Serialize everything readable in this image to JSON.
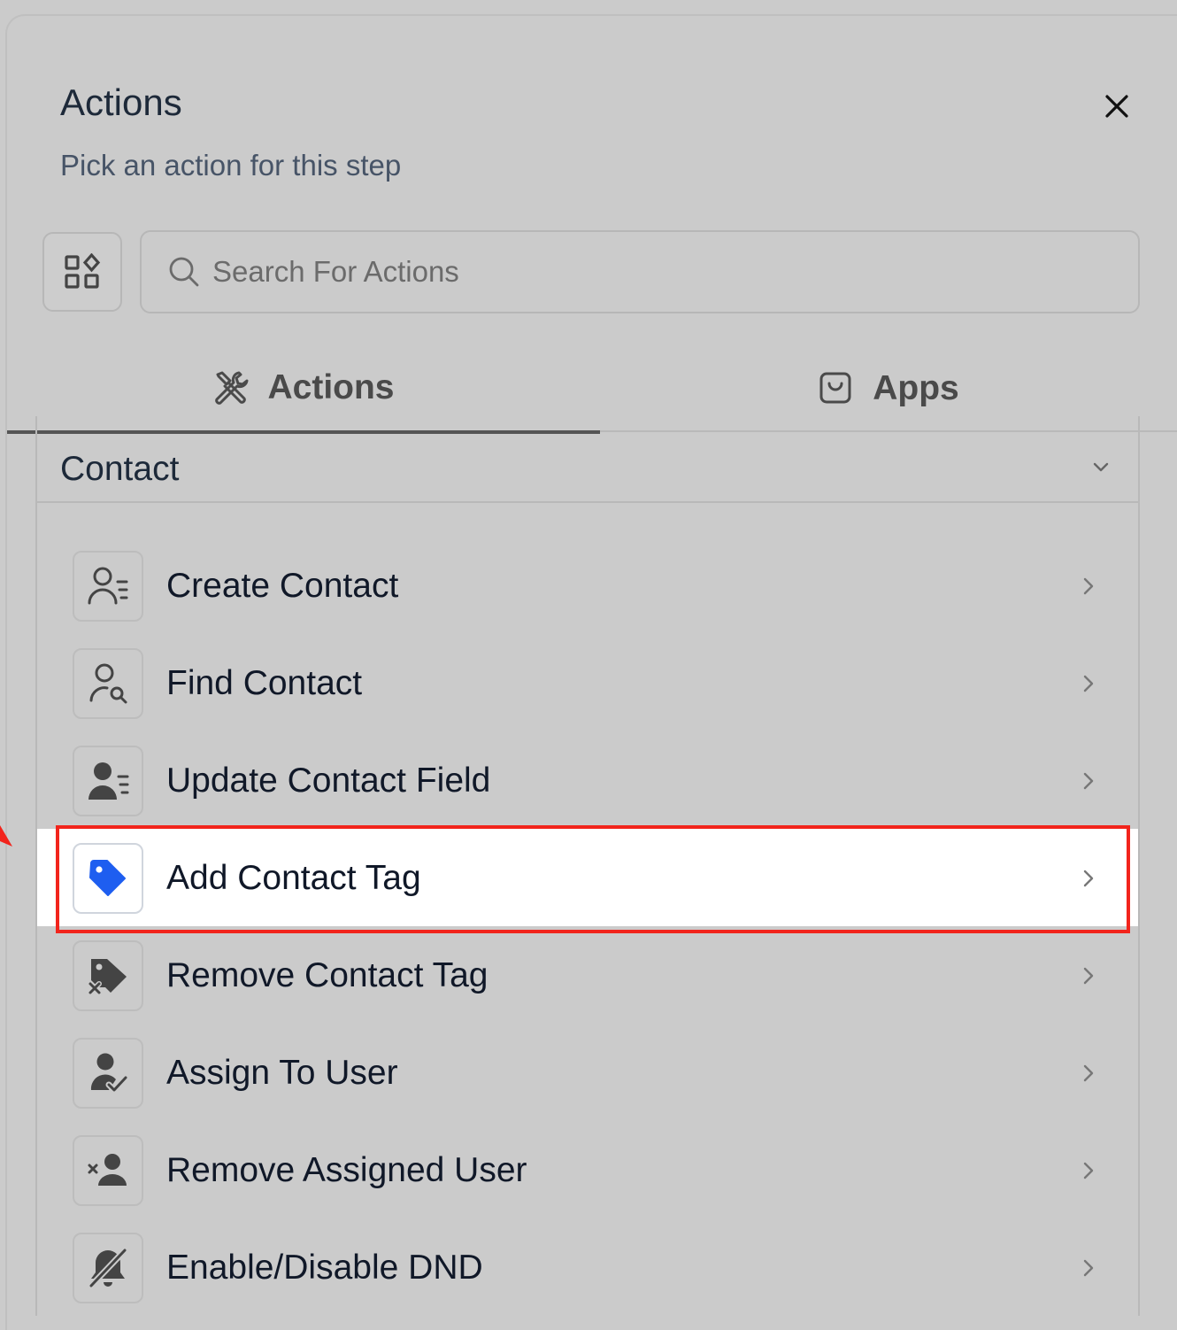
{
  "header": {
    "title": "Actions",
    "subtitle": "Pick an action for this step",
    "close_icon": "close-icon"
  },
  "search": {
    "placeholder": "Search For Actions",
    "value": ""
  },
  "tabs": [
    {
      "label": "Actions",
      "icon": "tools-icon",
      "active": true
    },
    {
      "label": "Apps",
      "icon": "bag-icon",
      "active": false
    }
  ],
  "section": {
    "title": "Contact",
    "expanded": true,
    "items": [
      {
        "label": "Create Contact",
        "icon": "contact-create-icon"
      },
      {
        "label": "Find Contact",
        "icon": "contact-find-icon"
      },
      {
        "label": "Update Contact Field",
        "icon": "contact-update-icon"
      },
      {
        "label": "Add Contact Tag",
        "icon": "tag-icon",
        "highlighted": true
      },
      {
        "label": "Remove Contact Tag",
        "icon": "tag-remove-icon"
      },
      {
        "label": "Assign To User",
        "icon": "user-check-icon"
      },
      {
        "label": "Remove Assigned User",
        "icon": "user-remove-icon"
      },
      {
        "label": "Enable/Disable DND",
        "icon": "bell-off-icon"
      }
    ]
  },
  "colors": {
    "background": "#cbcbcb",
    "highlight_border": "#f2241c",
    "tag_blue": "#1e5ef0",
    "icon_gray": "#4a4a4a"
  }
}
